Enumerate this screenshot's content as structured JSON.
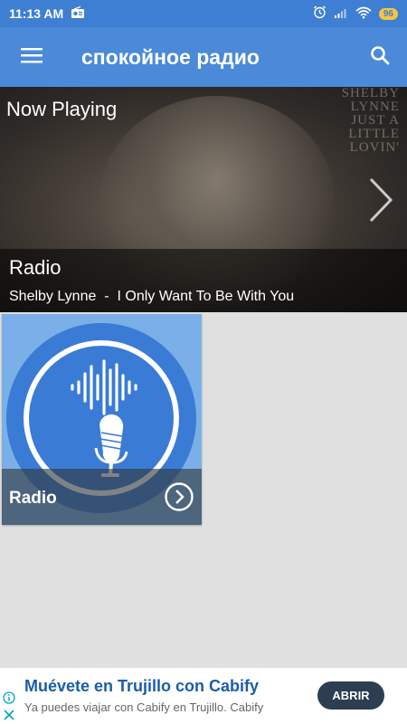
{
  "status_bar": {
    "time": "11:13 AM",
    "battery": "96",
    "icons": [
      "radio-icon",
      "alarm-icon",
      "signal-icon",
      "wifi-icon",
      "battery-icon"
    ]
  },
  "app_bar": {
    "title": "спокойное радио",
    "icons": [
      "menu-icon",
      "search-icon"
    ]
  },
  "now_playing": {
    "heading": "Now Playing",
    "album_text": [
      "SHELBY",
      "LYNNE",
      "JUST A",
      "LITTLE",
      "LOVIN'"
    ],
    "station": "Radio",
    "artist": "Shelby Lynne",
    "separator": "-",
    "song": "I Only Want To Be With You"
  },
  "stations": [
    {
      "label": "Radio",
      "icon": "microphone-icon"
    }
  ],
  "ad": {
    "title": "Muévete en Trujillo con Cabify",
    "subtitle": "Ya puedes viajar con Cabify en Trujillo. Cabify",
    "cta": "ABRIR"
  },
  "colors": {
    "status_bar": "#3f7fd3",
    "app_bar": "#4a8ad8",
    "background": "#e0e0e0",
    "card": "#7ab0e7",
    "ad_title": "#1a5da8",
    "ad_button": "#2c3e4f"
  }
}
